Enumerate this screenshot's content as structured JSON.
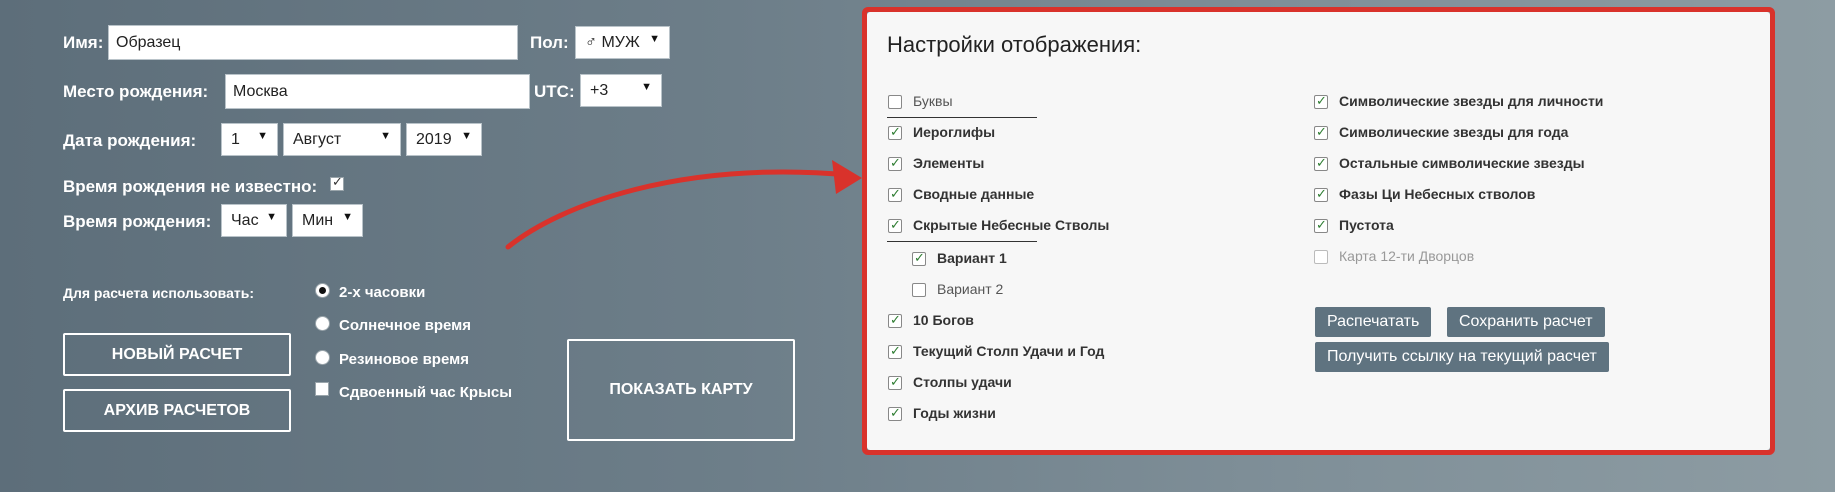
{
  "form": {
    "name_label": "Имя:",
    "name_value": "Образец",
    "gender_label": "Пол:",
    "gender_value": "♂ МУЖ",
    "birthplace_label": "Место рождения:",
    "birthplace_value": "Москва",
    "utc_label": "UTC:",
    "utc_value": "+3",
    "birthdate_label": "Дата рождения:",
    "day_value": "1",
    "month_value": "Август",
    "year_value": "2019",
    "time_unknown_label": "Время рождения не известно:",
    "time_unknown_checked": true,
    "birthtime_label": "Время рождения:",
    "hour_value": "Час",
    "minute_value": "Мин"
  },
  "calc": {
    "use_label": "Для расчета использовать:",
    "options": [
      {
        "label": "2-х часовки",
        "selected": true
      },
      {
        "label": "Солнечное время",
        "selected": false
      },
      {
        "label": "Резиновое время",
        "selected": false
      }
    ],
    "double_rat_label": "Сдвоенный час Крысы",
    "new_calc_label": "НОВЫЙ РАСЧЕТ",
    "archive_label": "АРХИВ РАСЧЕТОВ",
    "show_map_label": "ПОКАЗАТЬ КАРТУ"
  },
  "settings": {
    "title": "Настройки отображения:",
    "left": [
      {
        "label": "Буквы",
        "checked": false
      },
      {
        "label": "Иероглифы",
        "checked": true
      },
      {
        "label": "Элементы",
        "checked": true
      },
      {
        "label": "Сводные данные",
        "checked": true
      },
      {
        "label": "Скрытые Небесные Стволы",
        "checked": true
      },
      {
        "label": "Вариант 1",
        "checked": true
      },
      {
        "label": "Вариант 2",
        "checked": false
      },
      {
        "label": "10 Богов",
        "checked": true
      },
      {
        "label": "Текущий Столп Удачи и Год",
        "checked": true
      },
      {
        "label": "Столпы удачи",
        "checked": true
      },
      {
        "label": "Годы жизни",
        "checked": true
      }
    ],
    "right": [
      {
        "label": "Символические звезды для личности",
        "checked": true
      },
      {
        "label": "Символические звезды для года",
        "checked": true
      },
      {
        "label": "Остальные символические звезды",
        "checked": true
      },
      {
        "label": "Фазы Ци Небесных стволов",
        "checked": true
      },
      {
        "label": "Пустота",
        "checked": true
      },
      {
        "label": "Карта 12-ти Дворцов",
        "checked": false
      }
    ],
    "print_label": "Распечатать",
    "save_label": "Сохранить расчет",
    "link_label": "Получить ссылку на текущий расчет"
  },
  "colors": {
    "highlight_border": "#d9322b",
    "button": "#5f7380"
  }
}
